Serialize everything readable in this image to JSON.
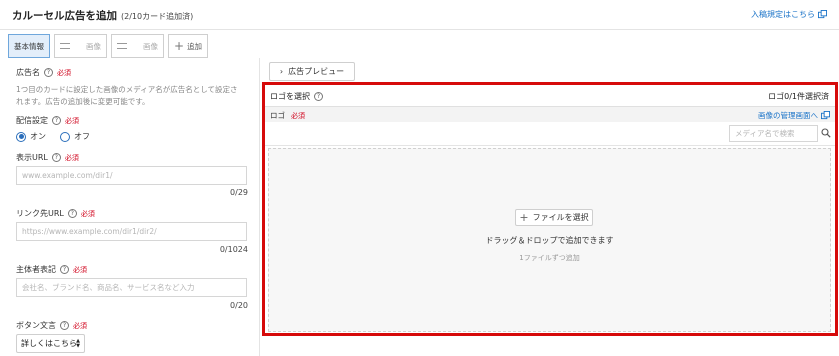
{
  "header": {
    "title": "カルーセル広告を追加",
    "subtitle": "(2/10カード追加済)",
    "policy_link": "入稿規定はこちら"
  },
  "tabs": [
    {
      "label": "基本情報"
    },
    {
      "label": "画像"
    },
    {
      "label": "画像"
    },
    {
      "label": "追加"
    }
  ],
  "form": {
    "ad_name": {
      "label": "広告名",
      "required": "必須",
      "description": "1つ目のカードに設定した画像のメディア名が広告名として設定されます。広告の追加後に変更可能です。"
    },
    "delivery": {
      "label": "配信設定",
      "required": "必須",
      "on_label": "オン",
      "off_label": "オフ",
      "selected": "オン"
    },
    "display_url": {
      "label": "表示URL",
      "required": "必須",
      "placeholder": "www.example.com/dir1/",
      "counter": "0/29"
    },
    "link_url": {
      "label": "リンク先URL",
      "required": "必須",
      "placeholder": "https://www.example.com/dir1/dir2/",
      "counter": "0/1024"
    },
    "advertiser": {
      "label": "主体者表記",
      "required": "必須",
      "placeholder": "会社名、ブランド名、商品名、サービス名など入力",
      "counter": "0/20"
    },
    "button_text": {
      "label": "ボタン文言",
      "required": "必須",
      "selected": "詳しくはこちら"
    }
  },
  "preview": {
    "button_label": "広告プレビュー"
  },
  "logo_panel": {
    "title": "ロゴを選択",
    "selected_count": "ロゴ0/1件選択済",
    "logo_label": "ロゴ",
    "required": "必須",
    "manage_link": "画像の管理画面へ",
    "search_placeholder": "メディア名で検索",
    "file_button": "ファイルを選択",
    "drop_text": "ドラッグ＆ドロップで追加できます",
    "drop_note": "1ファイルずつ追加"
  },
  "colors": {
    "accent": "#1a73c8",
    "required": "#d0021b",
    "highlight_border": "#d60a0a",
    "active_tab_bg": "#e3eefa"
  }
}
